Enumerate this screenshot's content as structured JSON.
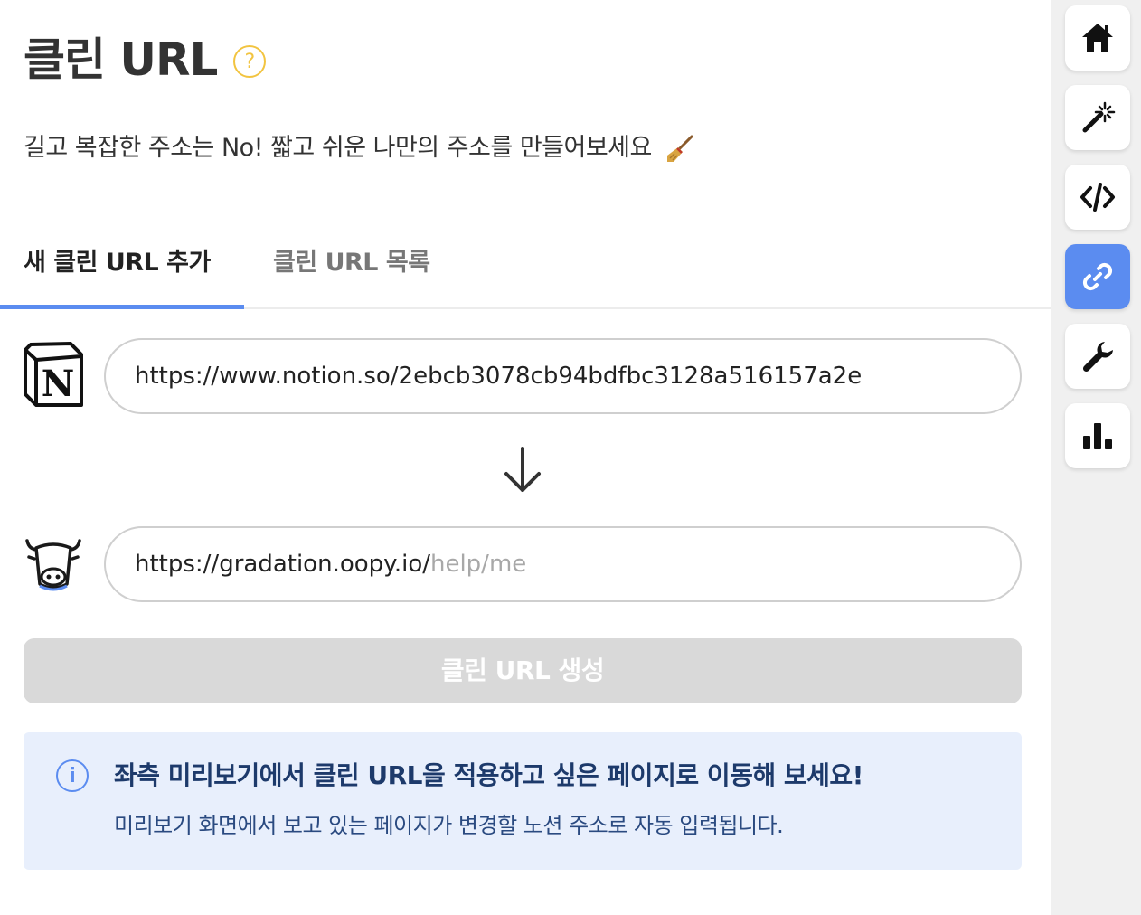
{
  "header": {
    "title": "클린 URL",
    "help_icon": "?",
    "subtitle": "길고 복잡한 주소는 No! 짧고 쉬운 나만의 주소를 만들어보세요"
  },
  "tabs": [
    {
      "label": "새 클린 URL 추가",
      "active": true
    },
    {
      "label": "클린 URL 목록",
      "active": false
    }
  ],
  "source": {
    "logo": "notion-logo",
    "value": "https://www.notion.so/2ebcb3078cb94bdfbc3128a516157a2e"
  },
  "target": {
    "logo": "oopy-cow-logo",
    "prefix": "https://gradation.oopy.io/",
    "placeholder": "help/me"
  },
  "create_button": {
    "label": "클린 URL 생성"
  },
  "info": {
    "icon": "i",
    "title": "좌측 미리보기에서 클린 URL을 적용하고 싶은 페이지로 이동해 보세요!",
    "description": "미리보기 화면에서 보고 있는 페이지가 변경할 노션 주소로 자동 입력됩니다."
  },
  "sidebar": {
    "items": [
      {
        "icon": "home-icon",
        "active": false
      },
      {
        "icon": "magic-wand-icon",
        "active": false
      },
      {
        "icon": "code-icon",
        "active": false
      },
      {
        "icon": "link-icon",
        "active": true
      },
      {
        "icon": "wrench-icon",
        "active": false
      },
      {
        "icon": "bar-chart-icon",
        "active": false
      }
    ]
  },
  "colors": {
    "accent": "#5b8cf0",
    "help": "#f2c440",
    "info_bg": "#e8effc",
    "disabled_button": "#d9d9d9"
  }
}
